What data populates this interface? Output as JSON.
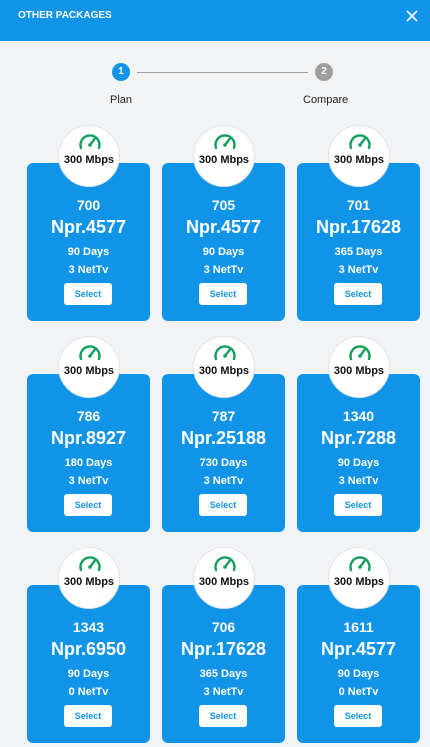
{
  "header": {
    "title": "OTHER PACKAGES"
  },
  "stepper": {
    "steps": [
      {
        "number": "1",
        "label": "Plan"
      },
      {
        "number": "2",
        "label": "Compare"
      }
    ]
  },
  "colors": {
    "accent": "#1094e8",
    "inactive": "#9e9e9e",
    "gauge": "#12a05c"
  },
  "packages": [
    {
      "speed": "300 Mbps",
      "id": "700",
      "price": "Npr.4577",
      "days": "90 Days",
      "nettv": "3 NetTv",
      "select_label": "Select"
    },
    {
      "speed": "300 Mbps",
      "id": "705",
      "price": "Npr.4577",
      "days": "90 Days",
      "nettv": "3 NetTv",
      "select_label": "Select"
    },
    {
      "speed": "300 Mbps",
      "id": "701",
      "price": "Npr.17628",
      "days": "365 Days",
      "nettv": "3 NetTv",
      "select_label": "Select"
    },
    {
      "speed": "300 Mbps",
      "id": "786",
      "price": "Npr.8927",
      "days": "180 Days",
      "nettv": "3 NetTv",
      "select_label": "Select"
    },
    {
      "speed": "300 Mbps",
      "id": "787",
      "price": "Npr.25188",
      "days": "730 Days",
      "nettv": "3 NetTv",
      "select_label": "Select"
    },
    {
      "speed": "300 Mbps",
      "id": "1340",
      "price": "Npr.7288",
      "days": "90 Days",
      "nettv": "3 NetTv",
      "select_label": "Select"
    },
    {
      "speed": "300 Mbps",
      "id": "1343",
      "price": "Npr.6950",
      "days": "90 Days",
      "nettv": "0 NetTv",
      "select_label": "Select"
    },
    {
      "speed": "300 Mbps",
      "id": "706",
      "price": "Npr.17628",
      "days": "365 Days",
      "nettv": "3 NetTv",
      "select_label": "Select"
    },
    {
      "speed": "300 Mbps",
      "id": "1611",
      "price": "Npr.4577",
      "days": "90 Days",
      "nettv": "0 NetTv",
      "select_label": "Select"
    }
  ]
}
